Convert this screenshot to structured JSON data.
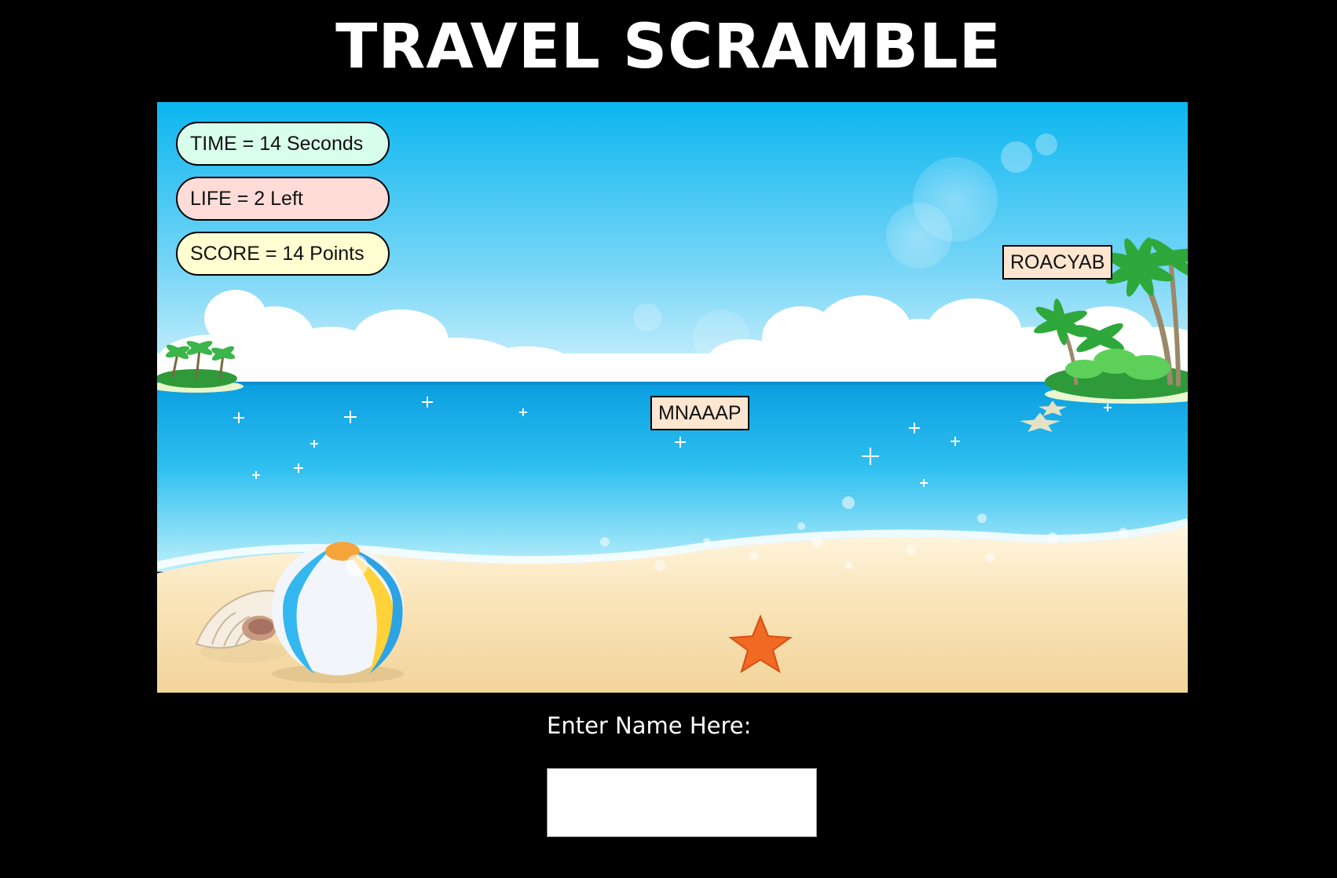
{
  "game": {
    "title": "TRAVEL SCRAMBLE"
  },
  "hud": {
    "time_text": "TIME = 14 Seconds",
    "life_text": "LIFE = 2 Left",
    "score_text": "SCORE = 14 Points",
    "colors": {
      "time_bg": "#d8ffec",
      "life_bg": "#ffdcd8",
      "score_bg": "#ffffd2"
    }
  },
  "words": [
    {
      "text": "ROACYAB"
    },
    {
      "text": "MNAAAP"
    }
  ],
  "form": {
    "label": "Enter Name Here:",
    "input_value": "",
    "input_placeholder": ""
  },
  "scene": {
    "description_icons": [
      "beach-ball-icon",
      "seashell-icon",
      "starfish-icon",
      "palm-tree-icon",
      "island-icon",
      "cloud-icon",
      "sparkle-icon"
    ],
    "colors": {
      "sky_top": "#0bb6ef",
      "sky_bottom": "#c8effc",
      "sea": "#1aa8e6",
      "sand": "#f6dca8",
      "background": "#000000"
    }
  }
}
